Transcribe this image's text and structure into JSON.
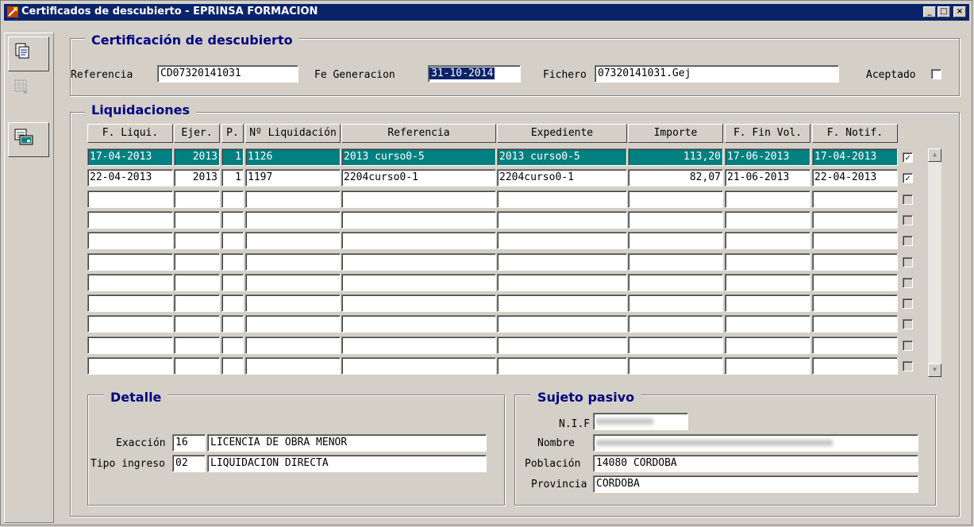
{
  "window": {
    "title": "Certificados de descubierto - EPRINSA FORMACION",
    "buttons": {
      "minimize": "_",
      "maximize": "□",
      "close": "×"
    }
  },
  "toolbar": {
    "icons": [
      "document-edit-icon",
      "grid-disabled-icon",
      "window-print-icon"
    ]
  },
  "certificacion": {
    "title": "Certificación de descubierto",
    "referencia_label": "Referencia",
    "referencia_value": "CD07320141031",
    "fe_generacion_label": "Fe Generacion",
    "fe_generacion_value": "31-10-2014",
    "fichero_label": "Fichero",
    "fichero_value": "07320141031.Gej",
    "aceptado_label": "Aceptado",
    "aceptado_checked": false
  },
  "liquidaciones": {
    "title": "Liquidaciones",
    "columns": [
      "F. Liqui.",
      "Ejer.",
      "P.",
      "Nº Liquidación",
      "Referencia",
      "Expediente",
      "Importe",
      "F. Fin Vol.",
      "F. Notif."
    ],
    "rows": [
      {
        "f_liqui": "17-04-2013",
        "ejer": "2013",
        "p": "1",
        "n_liq": "1126",
        "referencia": "2013 curso0-5",
        "expediente": "2013 curso0-5",
        "importe": "113,20",
        "f_fin_vol": "17-06-2013",
        "f_notif": "17-04-2013",
        "checked": true
      },
      {
        "f_liqui": "22-04-2013",
        "ejer": "2013",
        "p": "1",
        "n_liq": "1197",
        "referencia": "2204curso0-1",
        "expediente": "2204curso0-1",
        "importe": "82,07",
        "f_fin_vol": "21-06-2013",
        "f_notif": "22-04-2013",
        "checked": true
      },
      {
        "f_liqui": "",
        "ejer": "",
        "p": "",
        "n_liq": "",
        "referencia": "",
        "expediente": "",
        "importe": "",
        "f_fin_vol": "",
        "f_notif": "",
        "checked": false
      },
      {
        "f_liqui": "",
        "ejer": "",
        "p": "",
        "n_liq": "",
        "referencia": "",
        "expediente": "",
        "importe": "",
        "f_fin_vol": "",
        "f_notif": "",
        "checked": false
      },
      {
        "f_liqui": "",
        "ejer": "",
        "p": "",
        "n_liq": "",
        "referencia": "",
        "expediente": "",
        "importe": "",
        "f_fin_vol": "",
        "f_notif": "",
        "checked": false
      },
      {
        "f_liqui": "",
        "ejer": "",
        "p": "",
        "n_liq": "",
        "referencia": "",
        "expediente": "",
        "importe": "",
        "f_fin_vol": "",
        "f_notif": "",
        "checked": false
      },
      {
        "f_liqui": "",
        "ejer": "",
        "p": "",
        "n_liq": "",
        "referencia": "",
        "expediente": "",
        "importe": "",
        "f_fin_vol": "",
        "f_notif": "",
        "checked": false
      },
      {
        "f_liqui": "",
        "ejer": "",
        "p": "",
        "n_liq": "",
        "referencia": "",
        "expediente": "",
        "importe": "",
        "f_fin_vol": "",
        "f_notif": "",
        "checked": false
      },
      {
        "f_liqui": "",
        "ejer": "",
        "p": "",
        "n_liq": "",
        "referencia": "",
        "expediente": "",
        "importe": "",
        "f_fin_vol": "",
        "f_notif": "",
        "checked": false
      },
      {
        "f_liqui": "",
        "ejer": "",
        "p": "",
        "n_liq": "",
        "referencia": "",
        "expediente": "",
        "importe": "",
        "f_fin_vol": "",
        "f_notif": "",
        "checked": false
      },
      {
        "f_liqui": "",
        "ejer": "",
        "p": "",
        "n_liq": "",
        "referencia": "",
        "expediente": "",
        "importe": "",
        "f_fin_vol": "",
        "f_notif": "",
        "checked": false
      }
    ],
    "check_mark": "✓"
  },
  "detalle": {
    "title": "Detalle",
    "exaccion_label": "Exacción",
    "exaccion_code": "16",
    "exaccion_value": "LICENCIA DE OBRA MENOR",
    "tipo_label": "Tipo ingreso",
    "tipo_code": "02",
    "tipo_value": "LIQUIDACION DIRECTA"
  },
  "sujeto": {
    "title": "Sujeto pasivo",
    "nif_label": "N.I.F",
    "nif_value": "",
    "nombre_label": "Nombre",
    "nombre_value": "",
    "poblacion_label": "Población",
    "poblacion_value": "14080 CORDOBA",
    "provincia_label": "Provincia",
    "provincia_value": "CORDOBA"
  },
  "colors": {
    "title_bg": "#0a246a",
    "selected_row": "#008080",
    "group_title": "#000080",
    "face": "#d4d0c8"
  }
}
